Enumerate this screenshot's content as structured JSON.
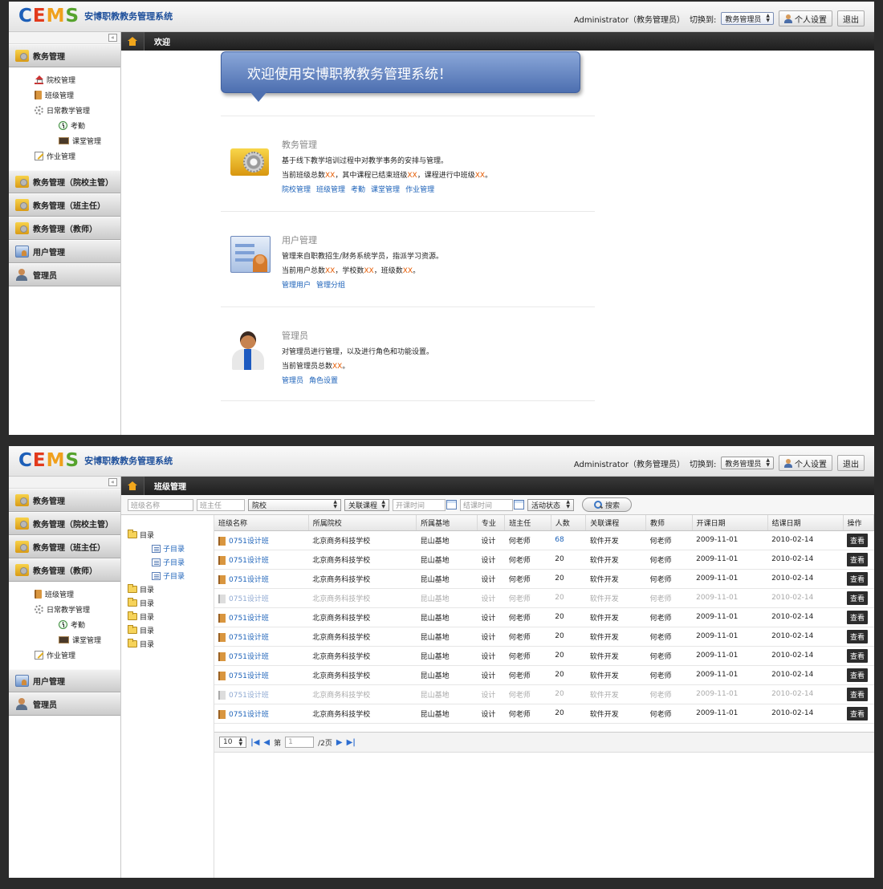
{
  "logo": {
    "c": "C",
    "e": "E",
    "m": "M",
    "s": "S"
  },
  "header": {
    "app_title": "安博职教教务管理系统",
    "user": "Administrator（教务管理员）",
    "switch_label": "切换到:",
    "role_value": "教务管理员",
    "settings_label": "个人设置",
    "logout_label": "退出"
  },
  "collapse_glyph": "«",
  "screen1": {
    "tab_label": "欢迎",
    "sidebar": {
      "head_edu": "教务管理",
      "items": [
        "院校管理",
        "班级管理",
        "日常教学管理",
        "考勤",
        "课堂管理",
        "作业管理"
      ],
      "heads": [
        "教务管理（院校主管）",
        "教务管理（班主任）",
        "教务管理（教师）",
        "用户管理",
        "管理员"
      ]
    },
    "welcome": "欢迎使用安博职教教务管理系统！",
    "cards": [
      {
        "title": "教务管理",
        "line1": "基于线下教学培训过程中对教学事务的安排与管理。",
        "line2_a": "当前班级总数",
        "line2_b": "，其中课程已结束班级",
        "line2_c": "，课程进行中班级",
        "line2_d": "。",
        "xx": "XX",
        "links": [
          "院校管理",
          "班级管理",
          "考勤",
          "课堂管理",
          "作业管理"
        ]
      },
      {
        "title": "用户管理",
        "line1": "管理来自职教招生/财务系统学员，指派学习资源。",
        "line2_a": "当前用户总数",
        "line2_b": "，学校数",
        "line2_c": "，班级数",
        "line2_d": "。",
        "xx": "XX",
        "links": [
          "管理用户",
          "管理分组"
        ]
      },
      {
        "title": "管理员",
        "line1": "对管理员进行管理，以及进行角色和功能设置。",
        "line2_a": "当前管理员总数",
        "line2_d": "。",
        "xx": "XX",
        "links": [
          "管理员",
          "角色设置"
        ]
      }
    ]
  },
  "screen2": {
    "tab_label": "班级管理",
    "sidebar": {
      "heads_top": [
        "教务管理",
        "教务管理（院校主管）",
        "教务管理（班主任）",
        "教务管理（教师）"
      ],
      "items": [
        "班级管理",
        "日常教学管理",
        "考勤",
        "课堂管理",
        "作业管理"
      ],
      "heads_bottom": [
        "用户管理",
        "管理员"
      ]
    },
    "filters": {
      "class_name": "班级名称",
      "teacher": "班主任",
      "school": "院校",
      "course": "关联课程",
      "start": "开课时间",
      "end": "结课时间",
      "status": "活动状态",
      "search": "搜索"
    },
    "tree": {
      "root": "目录",
      "children": [
        "子目录",
        "子目录",
        "子目录"
      ],
      "others": [
        "目录",
        "目录",
        "目录",
        "目录",
        "目录"
      ]
    },
    "columns": [
      "班级名称",
      "所属院校",
      "所属基地",
      "专业",
      "班主任",
      "人数",
      "关联课程",
      "教师",
      "开课日期",
      "结课日期",
      "操作"
    ],
    "rows": [
      {
        "name": "0751设计班",
        "school": "北京商务科技学校",
        "base": "昆山基地",
        "major": "设计",
        "head": "何老师",
        "count": "68",
        "course": "软件开发",
        "teacher": "何老师",
        "start": "2009-11-01",
        "end": "2010-02-14",
        "op": "查看",
        "dim": false
      },
      {
        "name": "0751设计班",
        "school": "北京商务科技学校",
        "base": "昆山基地",
        "major": "设计",
        "head": "何老师",
        "count": "20",
        "course": "软件开发",
        "teacher": "何老师",
        "start": "2009-11-01",
        "end": "2010-02-14",
        "op": "查看",
        "dim": false
      },
      {
        "name": "0751设计班",
        "school": "北京商务科技学校",
        "base": "昆山基地",
        "major": "设计",
        "head": "何老师",
        "count": "20",
        "course": "软件开发",
        "teacher": "何老师",
        "start": "2009-11-01",
        "end": "2010-02-14",
        "op": "查看",
        "dim": false
      },
      {
        "name": "0751设计班",
        "school": "北京商务科技学校",
        "base": "昆山基地",
        "major": "设计",
        "head": "何老师",
        "count": "20",
        "course": "软件开发",
        "teacher": "何老师",
        "start": "2009-11-01",
        "end": "2010-02-14",
        "op": "查看",
        "dim": true
      },
      {
        "name": "0751设计班",
        "school": "北京商务科技学校",
        "base": "昆山基地",
        "major": "设计",
        "head": "何老师",
        "count": "20",
        "course": "软件开发",
        "teacher": "何老师",
        "start": "2009-11-01",
        "end": "2010-02-14",
        "op": "查看",
        "dim": false
      },
      {
        "name": "0751设计班",
        "school": "北京商务科技学校",
        "base": "昆山基地",
        "major": "设计",
        "head": "何老师",
        "count": "20",
        "course": "软件开发",
        "teacher": "何老师",
        "start": "2009-11-01",
        "end": "2010-02-14",
        "op": "查看",
        "dim": false
      },
      {
        "name": "0751设计班",
        "school": "北京商务科技学校",
        "base": "昆山基地",
        "major": "设计",
        "head": "何老师",
        "count": "20",
        "course": "软件开发",
        "teacher": "何老师",
        "start": "2009-11-01",
        "end": "2010-02-14",
        "op": "查看",
        "dim": false
      },
      {
        "name": "0751设计班",
        "school": "北京商务科技学校",
        "base": "昆山基地",
        "major": "设计",
        "head": "何老师",
        "count": "20",
        "course": "软件开发",
        "teacher": "何老师",
        "start": "2009-11-01",
        "end": "2010-02-14",
        "op": "查看",
        "dim": false
      },
      {
        "name": "0751设计班",
        "school": "北京商务科技学校",
        "base": "昆山基地",
        "major": "设计",
        "head": "何老师",
        "count": "20",
        "course": "软件开发",
        "teacher": "何老师",
        "start": "2009-11-01",
        "end": "2010-02-14",
        "op": "查看",
        "dim": true
      },
      {
        "name": "0751设计班",
        "school": "北京商务科技学校",
        "base": "昆山基地",
        "major": "设计",
        "head": "何老师",
        "count": "20",
        "course": "软件开发",
        "teacher": "何老师",
        "start": "2009-11-01",
        "end": "2010-02-14",
        "op": "查看",
        "dim": false
      }
    ],
    "pager": {
      "page_size": "10",
      "first": "|◀",
      "prev": "◀",
      "page_prefix": "第",
      "page_value": "1",
      "page_suffix": "/2页",
      "next": "▶",
      "last": "▶|"
    }
  },
  "colors": {
    "accent": "#1c62b9",
    "xx": "#e55a00",
    "bubble": "#5b7cbf",
    "tabbar": "#2a2a2a"
  }
}
